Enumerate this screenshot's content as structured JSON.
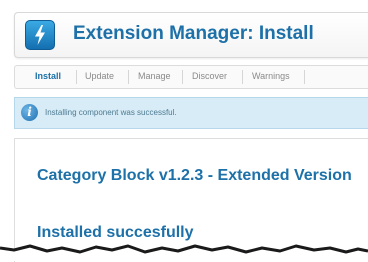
{
  "header": {
    "title": "Extension Manager: Install",
    "icon": "extension-lightning-icon"
  },
  "tabs": [
    {
      "label": "Install",
      "active": true
    },
    {
      "label": "Update",
      "active": false
    },
    {
      "label": "Manage",
      "active": false
    },
    {
      "label": "Discover",
      "active": false
    },
    {
      "label": "Warnings",
      "active": false
    }
  ],
  "message": {
    "icon": "info-icon",
    "text": "Installing component was successful."
  },
  "content": {
    "extension_name": "Category Block v1.2.3 - Extended Version",
    "status": "Installed succesfully"
  },
  "colors": {
    "accent": "#1d70a8",
    "message_bg": "#d7ecf6",
    "message_text": "#4e7a92",
    "tab_inactive": "#8a8a8a"
  }
}
